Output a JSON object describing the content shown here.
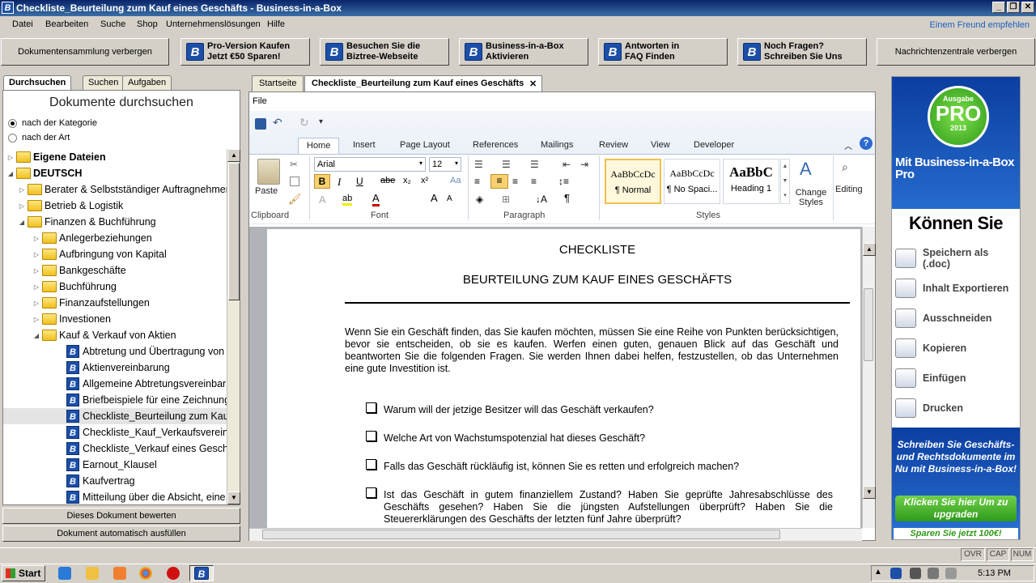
{
  "window": {
    "title": "Checkliste_Beurteilung zum Kauf eines Geschäfts - Business-in-a-Box",
    "min": "_",
    "restore": "❐",
    "close": "✕"
  },
  "menu": {
    "items": [
      "Datei",
      "Bearbeiten",
      "Suche",
      "Shop",
      "Unternehmenslösungen",
      "Hilfe"
    ],
    "friend": "Einem Freund empfehlen"
  },
  "toolbar": {
    "hide_docs": "Dokumentensammlung verbergen",
    "buttons": [
      {
        "l1": "Pro-Version Kaufen",
        "l2": "Jetzt €50 Sparen!"
      },
      {
        "l1": "Besuchen Sie die",
        "l2": "Biztree-Webseite"
      },
      {
        "l1": "Business-in-a-Box",
        "l2": "Aktivieren"
      },
      {
        "l1": "Antworten in",
        "l2": "FAQ Finden"
      },
      {
        "l1": "Noch Fragen?",
        "l2": "Schreiben Sie Uns"
      }
    ],
    "hide_news": "Nachrichtenzentrale verbergen",
    "logo_letter": "B"
  },
  "left": {
    "tabs": [
      "Durchsuchen",
      "Suchen",
      "Aufgaben"
    ],
    "title": "Dokumente durchsuchen",
    "radio1": "nach der Kategorie",
    "radio2": "nach der Art",
    "tree": [
      {
        "label": "Eigene Dateien",
        "kind": "folder",
        "level": 0,
        "bold": true,
        "arrow": "▷"
      },
      {
        "label": "DEUTSCH",
        "kind": "folder",
        "level": 0,
        "bold": true,
        "arrow": "◢"
      },
      {
        "label": "Berater & Selbstständiger Auftragnehmer",
        "kind": "folder",
        "level": 1,
        "arrow": "▷"
      },
      {
        "label": "Betrieb & Logistik",
        "kind": "folder",
        "level": 1,
        "arrow": "▷"
      },
      {
        "label": "Finanzen & Buchführung",
        "kind": "folder",
        "level": 1,
        "arrow": "◢"
      },
      {
        "label": "Anlegerbeziehungen",
        "kind": "folder",
        "level": 2,
        "arrow": "▷"
      },
      {
        "label": "Aufbringung von Kapital",
        "kind": "folder",
        "level": 2,
        "arrow": "▷"
      },
      {
        "label": "Bankgeschäfte",
        "kind": "folder",
        "level": 2,
        "arrow": "▷"
      },
      {
        "label": "Buchführung",
        "kind": "folder",
        "level": 2,
        "arrow": "▷"
      },
      {
        "label": "Finanzaufstellungen",
        "kind": "folder",
        "level": 2,
        "arrow": "▷"
      },
      {
        "label": "Investionen",
        "kind": "folder",
        "level": 2,
        "arrow": "▷"
      },
      {
        "label": "Kauf & Verkauf von Aktien",
        "kind": "folder",
        "level": 2,
        "arrow": "◢"
      },
      {
        "label": "Abtretung und Übertragung von",
        "kind": "doc",
        "level": 3
      },
      {
        "label": "Aktienvereinbarung",
        "kind": "doc",
        "level": 3
      },
      {
        "label": "Allgemeine Abtretungsvereinbarung",
        "kind": "doc",
        "level": 3
      },
      {
        "label": "Briefbeispiele für eine Zeichnung",
        "kind": "doc",
        "level": 3
      },
      {
        "label": "Checkliste_Beurteilung zum Kauf",
        "kind": "doc",
        "level": 3,
        "selected": true
      },
      {
        "label": "Checkliste_Kauf_Verkaufsvereinbarung",
        "kind": "doc",
        "level": 3
      },
      {
        "label": "Checkliste_Verkauf eines Geschäfts",
        "kind": "doc",
        "level": 3
      },
      {
        "label": "Earnout_Klausel",
        "kind": "doc",
        "level": 3
      },
      {
        "label": "Kaufvertrag",
        "kind": "doc",
        "level": 3
      },
      {
        "label": "Mitteilung über die Absicht, eine",
        "kind": "doc",
        "level": 3
      }
    ],
    "btn_rate": "Dieses Dokument bewerten",
    "btn_autofill": "Dokument automatisch ausfüllen"
  },
  "center": {
    "tabs": [
      "Startseite",
      "Checkliste_Beurteilung zum Kauf eines Geschäfts"
    ],
    "tab_close": "✕",
    "file_menu": "File",
    "ribbon_tabs": [
      "Home",
      "Insert",
      "Page Layout",
      "References",
      "Mailings",
      "Review",
      "View",
      "Developer"
    ],
    "font_name": "Arial",
    "font_size": "12",
    "groups": {
      "clipboard": "Clipboard",
      "font": "Font",
      "paragraph": "Paragraph",
      "styles": "Styles"
    },
    "paste": "Paste",
    "styles": [
      {
        "sample": "AaBbCcDc",
        "name": "¶ Normal"
      },
      {
        "sample": "AaBbCcDc",
        "name": "¶ No Spaci..."
      },
      {
        "sample": "AaBbC",
        "name": "Heading 1"
      }
    ],
    "change_styles": "Change Styles",
    "editing": "Editing",
    "font_btns": {
      "bold": "B",
      "italic": "I",
      "underline": "U",
      "strike": "abe",
      "sub": "x₂",
      "sup": "x²",
      "grow": "A",
      "shrink": "A",
      "color": "A",
      "pilcrow": "¶"
    }
  },
  "document": {
    "title1": "CHECKLISTE",
    "title2": "BEURTEILUNG ZUM KAUF EINES GESCHÄFTS",
    "intro": "Wenn Sie ein Geschäft finden, das Sie kaufen möchten, müssen Sie eine Reihe von Punkten berücksichtigen, bevor sie entscheiden, ob sie es kaufen. Werfen einen guten, genauen Blick auf das Geschäft und beantworten Sie die folgenden Fragen. Sie werden Ihnen dabei helfen, festzustellen, ob das Unternehmen eine gute Investition ist.",
    "questions": [
      "Warum will der jetzige Besitzer will das Geschäft verkaufen?",
      "Welche Art von Wachstumspotenzial hat dieses Geschäft?",
      "Falls das Geschäft rückläufig ist, können Sie es retten und erfolgreich machen?",
      "Ist das Geschäft in gutem finanziellem Zustand? Haben Sie geprüfte Jahresabschlüsse des Geschäfts gesehen? Haben Sie die jüngsten Aufstellungen überprüft? Haben Sie die Steuererklärungen des Geschäfts der letzten fünf Jahre überprüft?"
    ]
  },
  "ad": {
    "badge_top": "Ausgabe",
    "badge_pro": "PRO",
    "badge_year": "2013",
    "headline": "Mit Business-in-a-Box Pro",
    "subhead": "Können Sie",
    "actions": [
      "Speichern als (.doc)",
      "Inhalt Exportieren",
      "Ausschneiden",
      "Kopieren",
      "Einfügen",
      "Drucken"
    ],
    "bottom_text": "Schreiben Sie Geschäfts-und Rechtsdokumente im Nu mit Business-in-a-Box!",
    "cta": "Klicken Sie hier Um zu upgraden",
    "save": "Sparen Sie jetzt 100€!"
  },
  "status": {
    "indicators": [
      "OVR",
      "CAP",
      "NUM"
    ]
  },
  "taskbar": {
    "start": "Start",
    "time": "5:13 PM"
  },
  "colors": {
    "titlebar": "#0a246a",
    "accent": "#1c4fa8",
    "link": "#1c5fbf",
    "ad_blue": "#0b3ea0",
    "ad_green": "#3fb02a"
  }
}
